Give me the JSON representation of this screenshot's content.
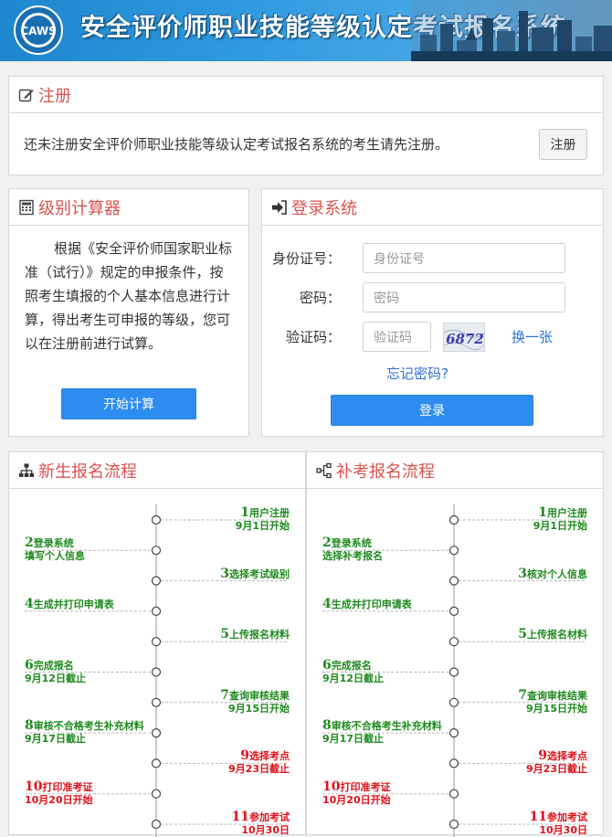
{
  "header": {
    "title": "安全评价师职业技能等级认定考试报名系统",
    "logo_text": "CAWS"
  },
  "register": {
    "title": "注册",
    "message": "还未注册安全评价师职业技能等级认定考试报名系统的考生请先注册。",
    "button": "注册"
  },
  "calculator": {
    "title": "级别计算器",
    "description": "根据《安全评价师国家职业标准（试行）》规定的申报条件，按照考生填报的个人基本信息进行计算，得出考生可申报的等级，您可以在注册前进行试算。",
    "button": "开始计算"
  },
  "login": {
    "title": "登录系统",
    "id_label": "身份证号：",
    "id_placeholder": "身份证号",
    "password_label": "密码：",
    "password_placeholder": "密码",
    "captcha_label": "验证码：",
    "captcha_placeholder": "验证码",
    "captcha_text": "6872",
    "refresh_captcha": "换一张",
    "forgot_password": "忘记密码?",
    "button": "登录"
  },
  "new_flow": {
    "title": "新生报名流程",
    "steps": [
      {
        "num": "1",
        "label": "用户注册",
        "sub": "9月1日开始",
        "side": "right",
        "color": "g"
      },
      {
        "num": "2",
        "label": "登录系统",
        "sub": "填写个人信息",
        "side": "left",
        "color": "g"
      },
      {
        "num": "3",
        "label": "选择考试级别",
        "sub": "",
        "side": "right",
        "color": "g"
      },
      {
        "num": "4",
        "label": "生成并打印申请表",
        "sub": "",
        "side": "left",
        "color": "g"
      },
      {
        "num": "5",
        "label": "上传报名材料",
        "sub": "",
        "side": "right",
        "color": "g"
      },
      {
        "num": "6",
        "label": "完成报名",
        "sub": "9月12日截止",
        "side": "left",
        "color": "g"
      },
      {
        "num": "7",
        "label": "查询审核结果",
        "sub": "9月15日开始",
        "side": "right",
        "color": "g"
      },
      {
        "num": "8",
        "label": "审核不合格考生补充材料",
        "sub": "9月17日截止",
        "side": "left",
        "color": "g"
      },
      {
        "num": "9",
        "label": "选择考点",
        "sub": "9月23日截止",
        "side": "right",
        "color": "r"
      },
      {
        "num": "10",
        "label": "打印准考证",
        "sub": "10月20日开始",
        "side": "left",
        "color": "r"
      },
      {
        "num": "11",
        "label": "参加考试",
        "sub": "10月30日",
        "side": "right",
        "color": "r"
      }
    ]
  },
  "makeup_flow": {
    "title": "补考报名流程",
    "steps": [
      {
        "num": "1",
        "label": "用户注册",
        "sub": "9月1日开始",
        "side": "right",
        "color": "g"
      },
      {
        "num": "2",
        "label": "登录系统",
        "sub": "选择补考报名",
        "side": "left",
        "color": "g"
      },
      {
        "num": "3",
        "label": "核对个人信息",
        "sub": "",
        "side": "right",
        "color": "g"
      },
      {
        "num": "4",
        "label": "生成并打印申请表",
        "sub": "",
        "side": "left",
        "color": "g"
      },
      {
        "num": "5",
        "label": "上传报名材料",
        "sub": "",
        "side": "right",
        "color": "g"
      },
      {
        "num": "6",
        "label": "完成报名",
        "sub": "9月12日截止",
        "side": "left",
        "color": "g"
      },
      {
        "num": "7",
        "label": "查询审核结果",
        "sub": "9月15日开始",
        "side": "right",
        "color": "g"
      },
      {
        "num": "8",
        "label": "审核不合格考生补充材料",
        "sub": "9月17日截止",
        "side": "left",
        "color": "g"
      },
      {
        "num": "9",
        "label": "选择考点",
        "sub": "9月23日截止",
        "side": "right",
        "color": "r"
      },
      {
        "num": "10",
        "label": "打印准考证",
        "sub": "10月20日开始",
        "side": "left",
        "color": "r"
      },
      {
        "num": "11",
        "label": "参加考试",
        "sub": "10月30日",
        "side": "right",
        "color": "r"
      }
    ]
  },
  "colors": {
    "accent_title": "#d9534f",
    "primary_button": "#2d8cf0",
    "step_green": "#1e8a1e",
    "step_red": "#e0111a"
  }
}
